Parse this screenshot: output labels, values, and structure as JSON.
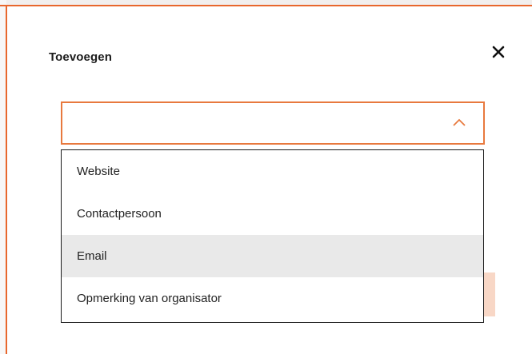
{
  "dialog": {
    "title": "Toevoegen"
  },
  "select": {
    "value": "",
    "expanded": true
  },
  "dropdown": {
    "options": [
      {
        "label": "Website"
      },
      {
        "label": "Contactpersoon"
      },
      {
        "label": "Email"
      },
      {
        "label": "Opmerking van organisator"
      }
    ],
    "highlighted_option": "Email"
  },
  "colors": {
    "accent": "#e8793e",
    "highlight": "#e9e9e9",
    "text": "#1c1c1c"
  },
  "icons": {
    "close": "close-icon",
    "chevron": "chevron-up-icon"
  }
}
